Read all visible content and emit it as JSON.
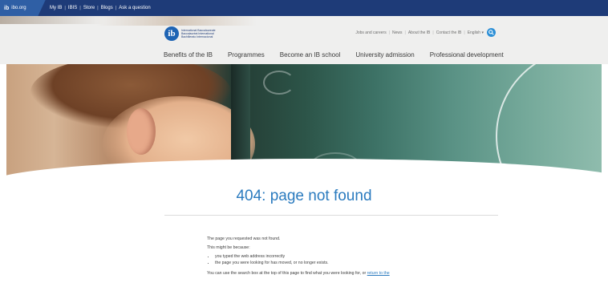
{
  "topbar": {
    "site": "ibo.org",
    "links": [
      "My IB",
      "IBIS",
      "Store",
      "Blogs",
      "Ask a question"
    ]
  },
  "header": {
    "logo_mark": "ib",
    "logo_lines": [
      "International Baccalaureate",
      "Baccalauréat International",
      "Bachillerato Internacional"
    ],
    "utility_links": [
      "Jobs and careers",
      "News",
      "About the IB",
      "Contact the IB"
    ],
    "language": "English ▾",
    "search_icon": "search-icon",
    "nav": [
      "Benefits of the IB",
      "Programmes",
      "Become an IB school",
      "University admission",
      "Professional development"
    ]
  },
  "main": {
    "title": "404: page not found",
    "intro": "The page you requested was not found.",
    "reason_intro": "This might be because:",
    "reasons": [
      "you typed the web address incorrectly",
      "the page you were looking for has moved, or no longer exists."
    ],
    "footer_text": "You can use the search box at the top of this page to find what you were looking for, or ",
    "footer_link": "return to the"
  },
  "colors": {
    "topbar": "#1e3b78",
    "accent": "#2b7bbf",
    "search": "#2c8fd6"
  }
}
